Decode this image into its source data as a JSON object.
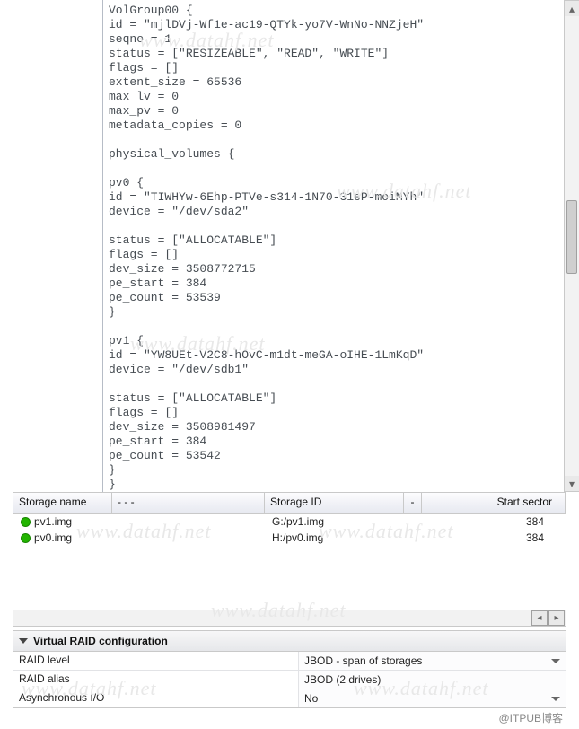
{
  "code_lines": [
    "VolGroup00 {",
    "id = \"mjlDVj-Wf1e-ac19-QTYk-yo7V-WnNo-NNZjeH\"",
    "seqno = 1",
    "status = [\"RESIZEABLE\", \"READ\", \"WRITE\"]",
    "flags = []",
    "extent_size = 65536",
    "max_lv = 0",
    "max_pv = 0",
    "metadata_copies = 0",
    "",
    "physical_volumes {",
    "",
    "pv0 {",
    "id = \"TIWHYw-6Ehp-PTVe-s314-1N70-31eP-moiMYh\"",
    "device = \"/dev/sda2\"",
    "",
    "status = [\"ALLOCATABLE\"]",
    "flags = []",
    "dev_size = 3508772715",
    "pe_start = 384",
    "pe_count = 53539",
    "}",
    "",
    "pv1 {",
    "id = \"YW8UEt-V2C8-hOvC-m1dt-meGA-oIHE-1LmKqD\"",
    "device = \"/dev/sdb1\"",
    "",
    "status = [\"ALLOCATABLE\"]",
    "flags = []",
    "dev_size = 3508981497",
    "pe_start = 384",
    "pe_count = 53542",
    "}",
    "}"
  ],
  "table": {
    "headers": {
      "name": "Storage name",
      "gap": "-        -        -",
      "id": "Storage ID",
      "gap2": "-",
      "sector": "Start sector"
    },
    "rows": [
      {
        "name": "pv1.img",
        "id": "G:/pv1.img",
        "sector": "384"
      },
      {
        "name": "pv0.img",
        "id": "H:/pv0.img",
        "sector": "384"
      }
    ]
  },
  "raid": {
    "title": "Virtual RAID configuration",
    "rows": [
      {
        "key": "RAID level",
        "value": "JBOD - span of storages",
        "dropdown": true
      },
      {
        "key": "RAID alias",
        "value": "JBOD (2 drives)",
        "dropdown": false
      },
      {
        "key": "Asynchronous I/O",
        "value": "No",
        "dropdown": true
      }
    ]
  },
  "watermark_text": "www.datahf.net",
  "footer": "@ITPUB博客"
}
